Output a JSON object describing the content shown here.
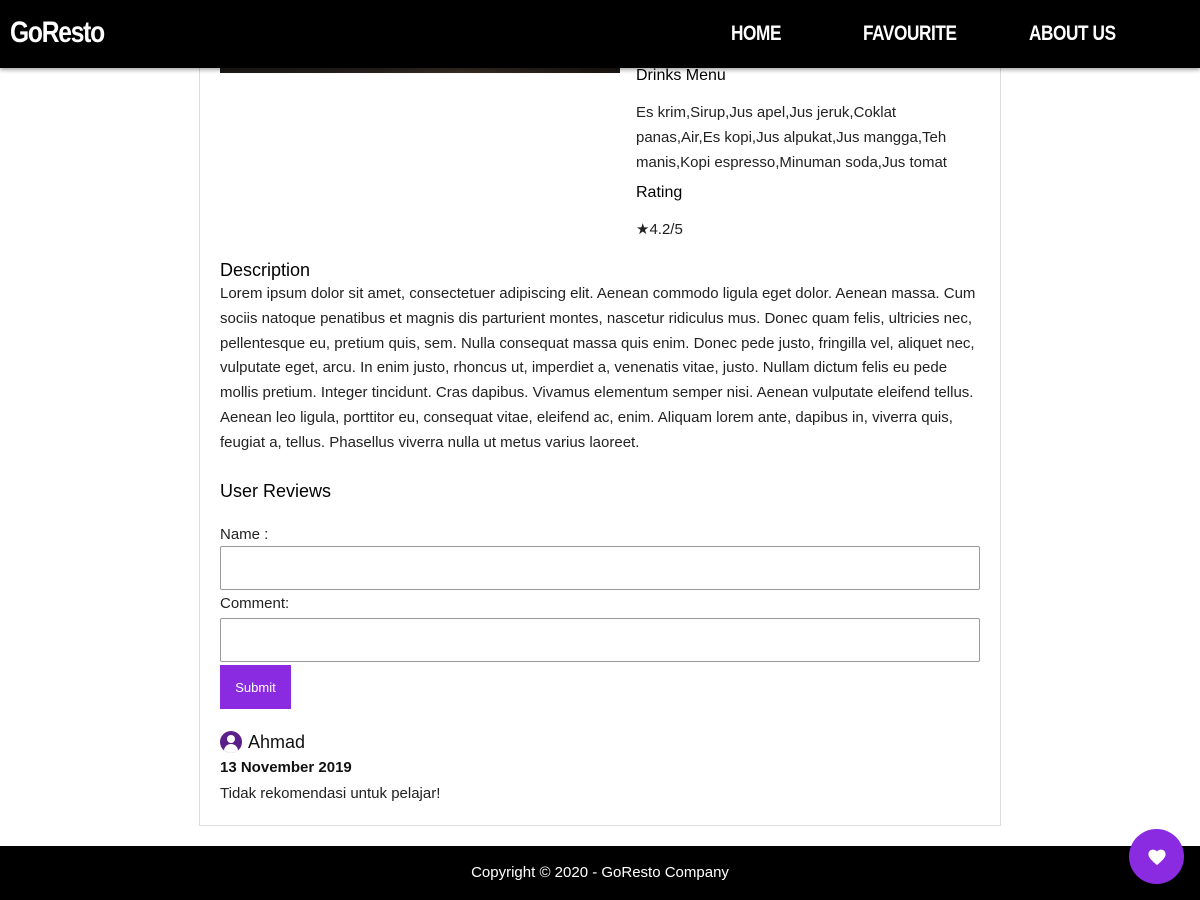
{
  "header": {
    "logo": "GoResto",
    "nav": {
      "home": "HOME",
      "favourite": "FAVOURITE",
      "about": "ABOUT US"
    }
  },
  "detail": {
    "drinks_title": "Drinks Menu",
    "drinks": "Es krim,Sirup,Jus apel,Jus jeruk,Coklat panas,Air,Es kopi,Jus alpukat,Jus mangga,Teh manis,Kopi espresso,Minuman soda,Jus tomat",
    "rating_title": "Rating",
    "rating": "★4.2/5",
    "description_title": "Description",
    "description": "Lorem ipsum dolor sit amet, consectetuer adipiscing elit. Aenean commodo ligula eget dolor. Aenean massa. Cum sociis natoque penatibus et magnis dis parturient montes, nascetur ridiculus mus. Donec quam felis, ultricies nec, pellentesque eu, pretium quis, sem. Nulla consequat massa quis enim. Donec pede justo, fringilla vel, aliquet nec, vulputate eget, arcu. In enim justo, rhoncus ut, imperdiet a, venenatis vitae, justo. Nullam dictum felis eu pede mollis pretium. Integer tincidunt. Cras dapibus. Vivamus elementum semper nisi. Aenean vulputate eleifend tellus. Aenean leo ligula, porttitor eu, consequat vitae, eleifend ac, enim. Aliquam lorem ante, dapibus in, viverra quis, feugiat a, tellus. Phasellus viverra nulla ut metus varius laoreet."
  },
  "reviews": {
    "title": "User Reviews",
    "form": {
      "name_label": "Name :",
      "name_value": "",
      "comment_label": "Comment:",
      "comment_value": "",
      "submit_label": "Submit"
    },
    "items": [
      {
        "name": "Ahmad",
        "date": "13 November 2019",
        "text": "Tidak rekomendasi untuk pelajar!"
      }
    ]
  },
  "footer": {
    "copyright": "Copyright © 2020 - GoResto Company"
  },
  "icons": {
    "avatar": "user-circle-icon",
    "favourite": "heart-icon"
  },
  "colors": {
    "accent": "#8a2be2",
    "header_bg": "#000000",
    "footer_bg": "#000000"
  }
}
